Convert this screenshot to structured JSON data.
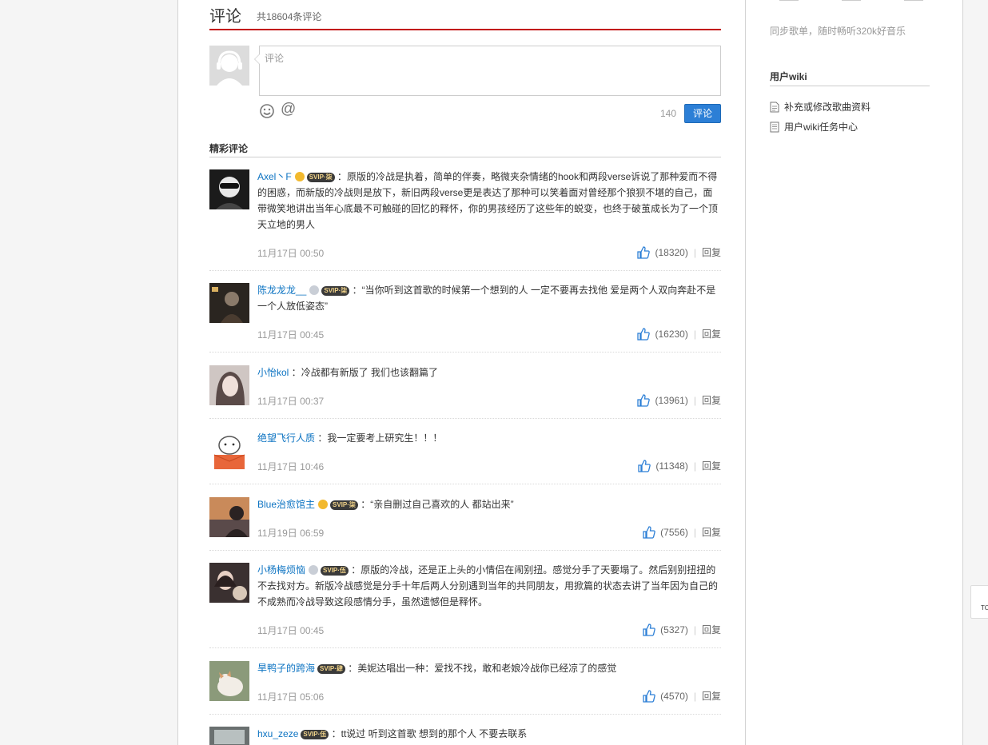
{
  "comments_section": {
    "title": "评论",
    "count_text": "共18604条评论",
    "input_placeholder": "评论",
    "char_limit": "140",
    "submit_label": "评论",
    "at_symbol": "@",
    "featured_title": "精彩评论"
  },
  "comments": [
    {
      "user": "Axel丶F",
      "crown": "gold",
      "vip": "SVIP·柒",
      "text": "原版的冷战是执着，简单的伴奏，略微夹杂情绪的hook和两段verse诉说了那种爱而不得的困惑，而新版的冷战则是放下，新旧两段verse更是表达了那种可以笑着面对曾经那个狼狈不堪的自己，面带微笑地讲出当年心底最不可触碰的回忆的释怀，你的男孩经历了这些年的蜕变，也终于破茧成长为了一个顶天立地的男人",
      "time": "11月17日 00:50",
      "likes": "(18320)",
      "reply": "回复"
    },
    {
      "user": "陈龙龙龙__",
      "crown": "silver",
      "vip": "SVIP·柒",
      "text": "“当你听到这首歌的时候第一个想到的人 一定不要再去找他 爱是两个人双向奔赴不是一个人放低姿态”",
      "time": "11月17日 00:45",
      "likes": "(16230)",
      "reply": "回复"
    },
    {
      "user": "小怡kol",
      "crown": "",
      "vip": "",
      "text": "冷战都有新版了 我们也该翻篇了",
      "time": "11月17日 00:37",
      "likes": "(13961)",
      "reply": "回复"
    },
    {
      "user": "绝望飞行人质",
      "crown": "",
      "vip": "",
      "text": "我一定要考上研究生！！！",
      "time": "11月17日 10:46",
      "likes": "(11348)",
      "reply": "回复"
    },
    {
      "user": "Blue治愈馆主",
      "crown": "gold",
      "vip": "SVIP·柒",
      "text": "“亲自删过自己喜欢的人 都站出来”",
      "time": "11月19日 06:59",
      "likes": "(7556)",
      "reply": "回复"
    },
    {
      "user": "小杨梅烦恼",
      "crown": "silver",
      "vip": "SVIP·伍",
      "text": "原版的冷战，还是正上头的小情侣在闹别扭。感觉分手了天要塌了。然后别别扭扭的不去找对方。新版冷战感觉是分手十年后两人分别遇到当年的共同朋友，用掀篇的状态去讲了当年因为自己的不成熟而冷战导致这段感情分手，虽然遗憾但是释怀。",
      "time": "11月17日 00:45",
      "likes": "(5327)",
      "reply": "回复"
    },
    {
      "user": "旱鸭子的跨海",
      "crown": "",
      "vip": "SVIP·肆",
      "text": "美妮达唱出一种：爱找不找，敢和老娘冷战你已经凉了的感觉",
      "time": "11月17日 05:06",
      "likes": "(4570)",
      "reply": "回复"
    },
    {
      "user": "hxu_zeze",
      "crown": "",
      "vip": "SVIP·伍",
      "text": "tt说过 听到这首歌 想到的那个人 不要去联系",
      "time": "",
      "likes": "",
      "reply": ""
    }
  ],
  "sidebar": {
    "sync_text": "同步歌单，随时畅听320k好音乐",
    "wiki_title": "用户wiki",
    "wiki_items": [
      "补充或修改歌曲资料",
      "用户wiki任务中心"
    ]
  },
  "back_to_top": "TO",
  "colors": {
    "accent_red": "#c20c0c",
    "link_blue": "#0c73c2",
    "button_blue": "#2c7fd6"
  }
}
